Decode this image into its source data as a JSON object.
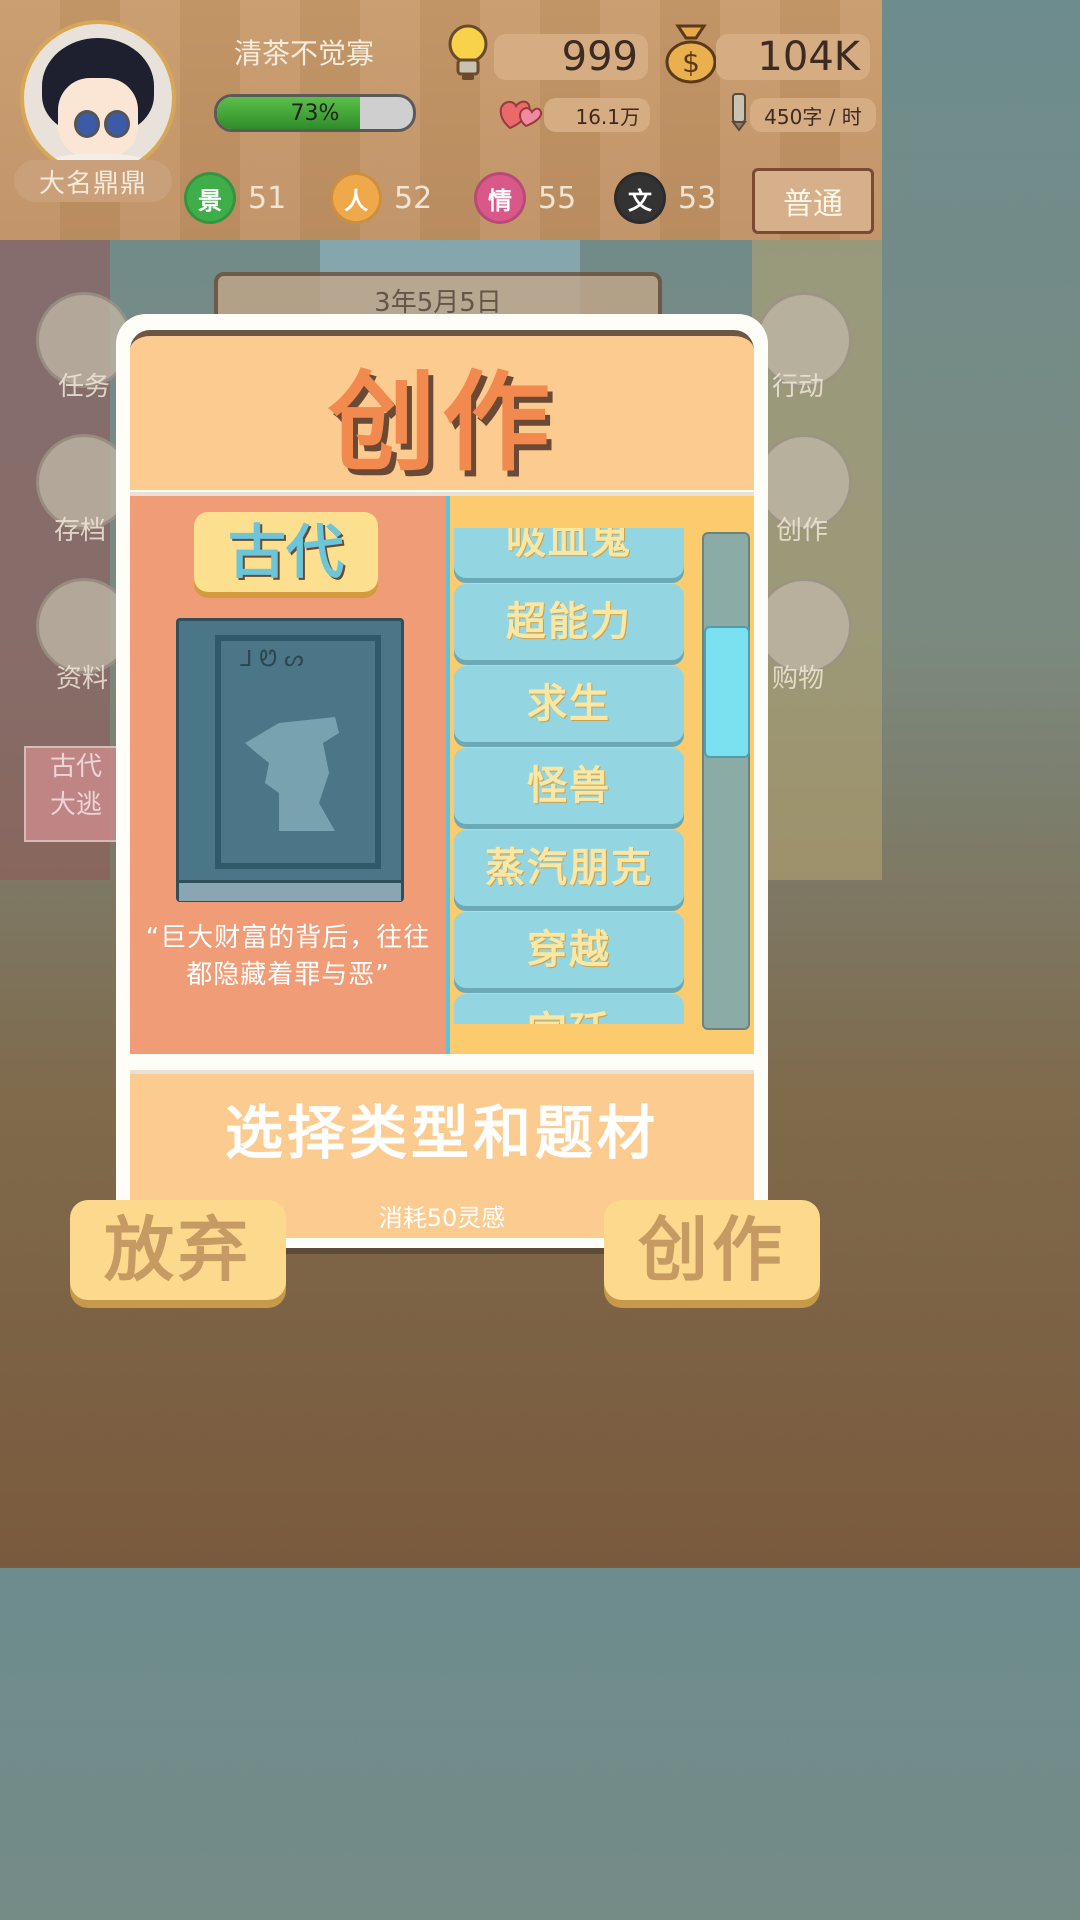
{
  "player": {
    "nickname": "大名鼎鼎",
    "username": "清茶不觉寡",
    "progress_text": "73%",
    "progress_value": 0.73
  },
  "resources": {
    "inspiration": "999",
    "money": "104K",
    "fans": "16.1万",
    "speed": "450字 / 时"
  },
  "stats": [
    {
      "icon": "景",
      "value": "51",
      "color": "#3fae4a"
    },
    {
      "icon": "人",
      "value": "52",
      "color": "#f0a94a"
    },
    {
      "icon": "情",
      "value": "55",
      "color": "#d9588a"
    },
    {
      "icon": "文",
      "value": "53",
      "color": "#333333"
    }
  ],
  "difficulty": "普通",
  "scene": {
    "date": "3年5月5日",
    "menu_left": [
      "任务",
      "存档",
      "资料"
    ],
    "menu_right": [
      "行动",
      "创作",
      "购物"
    ],
    "notice": "古代\n大逃"
  },
  "dialog": {
    "title": "创作",
    "selected_genre": "古代",
    "book_scribble": "ᒧ Ꮼ ᔕ",
    "quote": "“巨大财富的背后，往往都隐藏着罪与恶”",
    "topics": [
      "吸血鬼",
      "超能力",
      "求生",
      "怪兽",
      "蒸汽朋克",
      "穿越",
      "宫廷"
    ],
    "prompt": "选择类型和题材",
    "cost": "消耗50灵感",
    "scroll_position": 0.2
  },
  "buttons": {
    "abandon": "放弃",
    "create": "创作"
  }
}
